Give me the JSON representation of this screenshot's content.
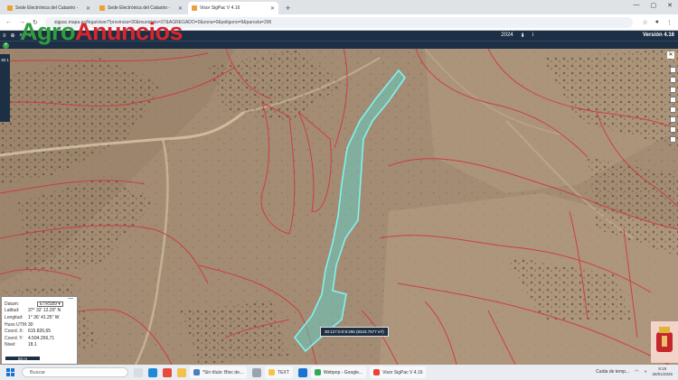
{
  "browser": {
    "tabs": [
      {
        "label": "Sede Electrónica del Catastro -",
        "color": "#f0a030",
        "active": false
      },
      {
        "label": "Sede Electrónica del Catastro -",
        "color": "#f0a030",
        "active": false
      },
      {
        "label": "Visor SigPac V 4.16",
        "color": "#e8a040",
        "active": true
      }
    ],
    "new_tab": "+",
    "url": "sigpac.mapa.es/fega/visor/?provincia=30&municipio=27&AGREGADO=0&zona=0&poligono=9&parcela=296",
    "window_controls": [
      "—",
      "▢",
      "✕"
    ]
  },
  "watermark": {
    "part1": "Agro",
    "part2": "Anuncios"
  },
  "app_toolbar": {
    "items": [
      "≡",
      "⊕",
      "⌕",
      "✎"
    ],
    "year": "2024",
    "right_icons": [
      "⬇",
      "i"
    ],
    "version": "Versión 4.16"
  },
  "left_panel": {
    "label": "30.1"
  },
  "parcel_tooltip": "30:127:0:0:9:296 (8343.7577 m²)",
  "coord_panel": {
    "datum_label": "Datum:",
    "datum_value": "ETRS89",
    "rows": [
      {
        "k": "Latitud:",
        "v": "37° 32' 12.20\" N"
      },
      {
        "k": "Longitud:",
        "v": "1° 36' 41.25\" W"
      },
      {
        "k": "Huso UTM:",
        "v": "30"
      },
      {
        "k": "Coord. X:",
        "v": "615.826,65"
      },
      {
        "k": "Coord. Y:",
        "v": "4.594.266,71"
      },
      {
        "k": "Nivel:",
        "v": "18.1"
      }
    ],
    "scale": "50 m"
  },
  "taskbar": {
    "search_placeholder": "Buscar",
    "tasks": [
      {
        "label": "*Sin título: Bloc de...",
        "color": "#4a7fc1"
      },
      {
        "label": "TEXT",
        "color": "#f5c542"
      },
      {
        "label": "Webpop - Google...",
        "color": "#34a853"
      },
      {
        "label": "Visor SigPac V 4.16",
        "color": "#e94235"
      }
    ],
    "weather": "Caída de temp...",
    "clock_time": "8:19",
    "clock_date": "26/01/2025"
  }
}
